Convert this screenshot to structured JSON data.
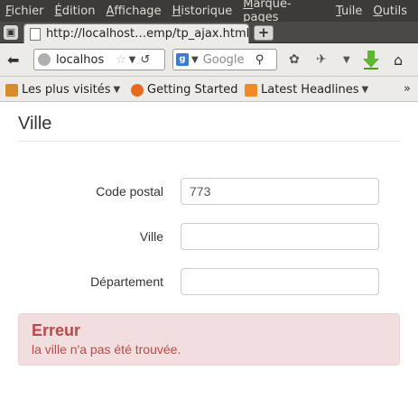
{
  "menu": {
    "items": [
      {
        "accel": "F",
        "rest": "ichier"
      },
      {
        "accel": "É",
        "rest": "dition"
      },
      {
        "accel": "A",
        "rest": "ffichage"
      },
      {
        "accel": "H",
        "rest": "istorique"
      },
      {
        "accel": "M",
        "rest": "arque-pages"
      },
      {
        "accel": "T",
        "rest": "uile"
      },
      {
        "accel": "O",
        "rest": "utils"
      }
    ]
  },
  "tab": {
    "title": "http://localhost…emp/tp_ajax.html",
    "new_tab_glyph": "+"
  },
  "navbar": {
    "url": "localhos",
    "search_placeholder": "Google",
    "search_engine_letter": "g"
  },
  "bookmarks": {
    "items": [
      {
        "label": "Les plus visités",
        "icon": "folder-icon",
        "color": "#d98c2b",
        "has_dropdown": true
      },
      {
        "label": "Getting Started",
        "icon": "firefox-icon",
        "color": "#e66b1f",
        "has_dropdown": false
      },
      {
        "label": "Latest Headlines",
        "icon": "rss-icon",
        "color": "#f08a24",
        "has_dropdown": true
      }
    ],
    "overflow": "»"
  },
  "page": {
    "title": "Ville",
    "form": {
      "code_postal": {
        "label": "Code postal",
        "value": "773"
      },
      "ville": {
        "label": "Ville",
        "value": ""
      },
      "departement": {
        "label": "Département",
        "value": ""
      }
    },
    "alert": {
      "title": "Erreur",
      "message": "la ville n'a pas été trouvée.",
      "color": "#b94a48",
      "background": "#f2dede"
    }
  }
}
